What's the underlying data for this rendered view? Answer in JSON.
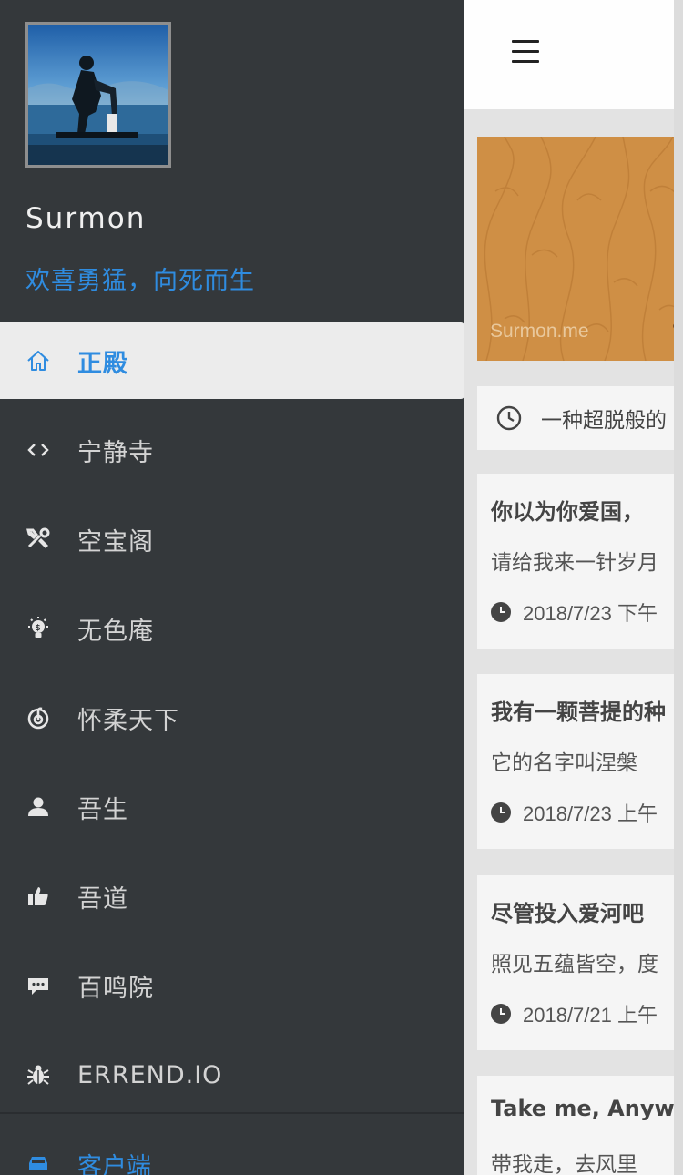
{
  "drawer": {
    "brand_name": "Surmon",
    "slogan": "欢喜勇猛，向死而生",
    "menu": [
      {
        "label": "正殿",
        "icon": "home-icon",
        "active": true
      },
      {
        "label": "宁静寺",
        "icon": "code-icon"
      },
      {
        "label": "空宝阁",
        "icon": "tools-icon"
      },
      {
        "label": "无色庵",
        "icon": "lightbulb-icon"
      },
      {
        "label": "怀柔天下",
        "icon": "netease-music-icon"
      },
      {
        "label": "吾生",
        "icon": "user-icon"
      },
      {
        "label": "吾道",
        "icon": "thumbs-up-icon"
      },
      {
        "label": "百鸣院",
        "icon": "comment-icon"
      },
      {
        "label": "ERREND.IO",
        "icon": "bug-icon"
      }
    ],
    "client_label": "客户端",
    "client_icon": "car-icon"
  },
  "main": {
    "banner_text": "Surmon.me",
    "notice": "一种超脱般的",
    "articles": [
      {
        "title": "你以为你爱国，",
        "desc": "请给我来一针岁月",
        "date": "2018/7/23 下午"
      },
      {
        "title": "我有一颗菩提的种",
        "desc": "它的名字叫涅槃",
        "date": "2018/7/23 上午"
      },
      {
        "title": "尽管投入爱河吧",
        "desc": "照见五蕴皆空，度",
        "date": "2018/7/21 上午"
      },
      {
        "title": "Take me, Anywh",
        "desc": "带我走，去风里",
        "date": ""
      }
    ]
  },
  "colors": {
    "drawer_bg": "#34383b",
    "accent": "#2f8ce0",
    "active_bg": "#ececec",
    "banner": "#cf8f45"
  }
}
